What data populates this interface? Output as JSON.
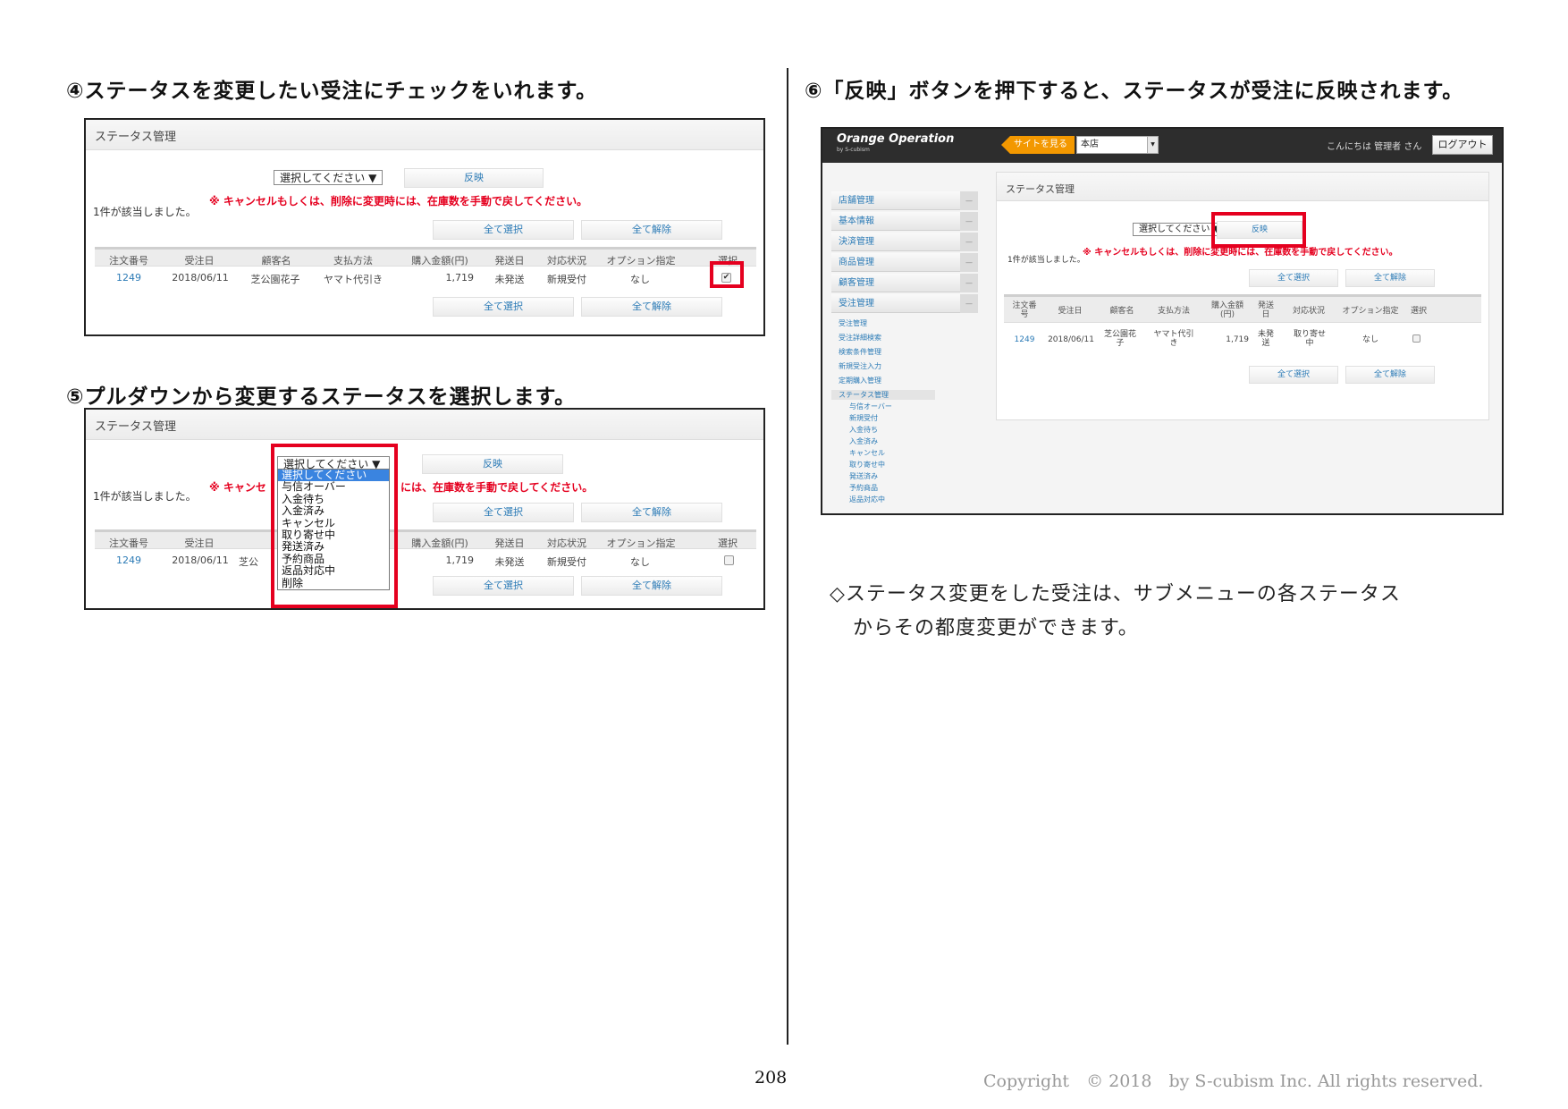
{
  "headings": {
    "step4": "④ステータスを変更したい受注にチェックをいれます。",
    "step5": "⑤プルダウンから変更するステータスを選択します。",
    "step6": "⑥「反映」ボタンを押下すると、ステータスが受注に反映されます。"
  },
  "panel": {
    "title": "ステータス管理",
    "select_placeholder": "選択してください ▼",
    "apply_button": "反映",
    "result_note": "1件が該当しました。",
    "warning": "※ キャンセルもしくは、削除に変更時には、在庫数を手動で戻してください。",
    "select_all": "全て選択",
    "deselect_all": "全て解除",
    "columns": [
      "注文番号",
      "受注日",
      "顧客名",
      "支払方法",
      "購入金額(円)",
      "発送日",
      "対応状況",
      "オプション指定",
      "選択"
    ],
    "row": {
      "order_no": "1249",
      "date": "2018/06/11",
      "customer": "芝公園花子",
      "payment": "ヤマト代引き",
      "amount": "1,719",
      "ship": "未発送",
      "status": "新規受付",
      "option": "なし"
    }
  },
  "panel5": {
    "warning_left": "※ キャンセ",
    "warning_right": "には、在庫数を手動で戻してください。",
    "customer_fragment": "芝公"
  },
  "dropdown": {
    "closed_label": "選択してください ▼",
    "options": [
      "選択してください",
      "与信オーバー",
      "入金待ち",
      "入金済み",
      "キャンセル",
      "取り寄せ中",
      "発送済み",
      "予約商品",
      "返品対応中",
      "削除"
    ]
  },
  "admin": {
    "logo": "Orange Operation",
    "logo_sub": "by S-cubism",
    "site_button": "サイトを見る",
    "store": "本店",
    "greeting": "こんにちは 管理者 さん",
    "logout": "ログアウト",
    "side_menu": [
      "店舗管理",
      "基本情報",
      "決済管理",
      "商品管理",
      "顧客管理",
      "受注管理"
    ],
    "side_sub": [
      "受注管理",
      "受注詳細検索",
      "検索条件管理",
      "新規受注入力",
      "定期購入管理",
      "ステータス管理"
    ],
    "side_sub3": [
      "与信オーバー",
      "新規受付",
      "入金待ち",
      "入金済み",
      "キャンセル",
      "取り寄せ中",
      "発送済み",
      "予約商品",
      "返品対応中"
    ],
    "columns": [
      "注文番号",
      "受注日",
      "顧客名",
      "支払方法",
      "購入金額(円)",
      "発送日",
      "対応状況",
      "オプション指定",
      "選択"
    ],
    "row": {
      "order_no": "1249",
      "date": "2018/06/11",
      "customer": "芝公園花子",
      "payment": "ヤマト代引き",
      "amount": "1,719",
      "ship": "未発送",
      "status": "取り寄せ中",
      "option": "なし"
    }
  },
  "footnote": {
    "line1": "◇ステータス変更をした受注は、サブメニューの各ステータス",
    "line2": "からその都度変更ができます。"
  },
  "footer": {
    "page_number": "208",
    "copyright": "Copyright　© 2018　by S-cubism Inc. All rights reserved."
  },
  "colors": {
    "highlight_red": "#e5001f",
    "link_blue": "#2c7bb6",
    "dropdown_selected": "#3a84e0",
    "site_button_orange": "#f39800"
  }
}
